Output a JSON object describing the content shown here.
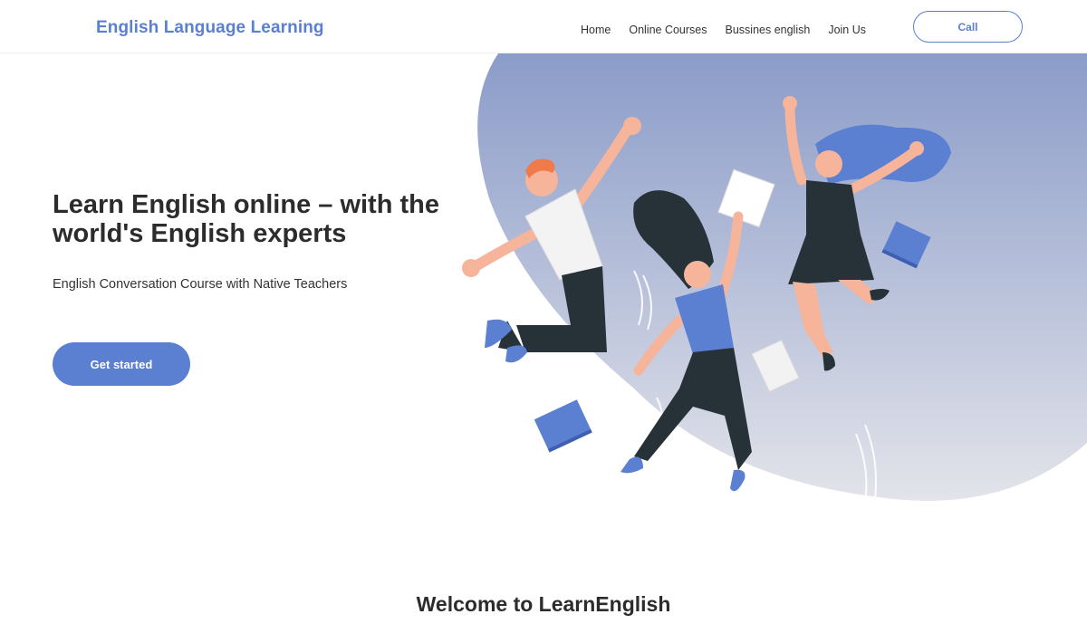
{
  "header": {
    "brand": "English Language Learning",
    "nav": [
      "Home",
      "Online Courses",
      "Bussines english",
      "Join Us"
    ],
    "call_label": "Call"
  },
  "hero": {
    "title": "Learn English online – with the world's English experts",
    "subtitle": "English Conversation Course with Native Teachers",
    "cta_label": "Get started"
  },
  "welcome": {
    "title": "Welcome to LearnEnglish"
  },
  "colors": {
    "accent": "#5b7fd1",
    "blob_top": "#8b9cc9",
    "blob_bottom": "#dfe1e8",
    "dark_clothes": "#263238",
    "skin": "#f6b49b"
  },
  "illustration": {
    "icons": [
      "jumping-people-illustration",
      "book-icon",
      "paper-sheet-icon"
    ]
  }
}
